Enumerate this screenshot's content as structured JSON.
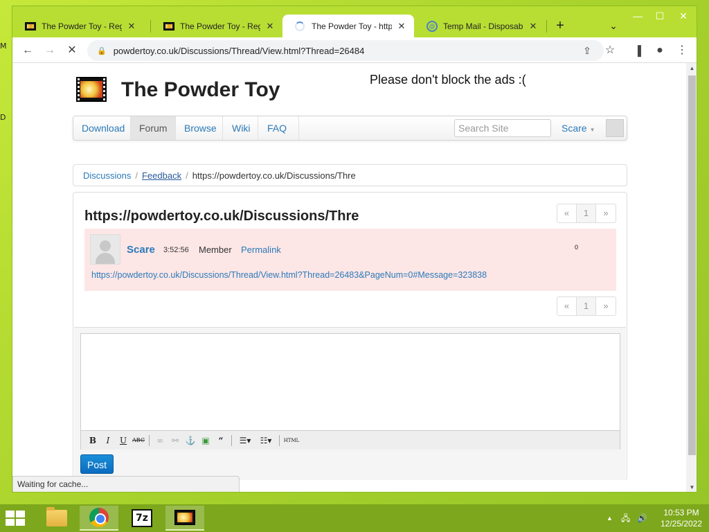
{
  "browser": {
    "tabs": [
      {
        "title": "The Powder Toy - Regis",
        "favicon": "powder-toy-icon",
        "active": false
      },
      {
        "title": "The Powder Toy - Regis",
        "favicon": "powder-toy-icon",
        "active": false
      },
      {
        "title": "The Powder Toy - https",
        "favicon": "loading-spinner-icon",
        "active": true
      },
      {
        "title": "Temp Mail - Disposable",
        "favicon": "temp-mail-icon",
        "active": false
      }
    ],
    "new_tab": "+",
    "tab_search": "⌄",
    "close_glyph": "✕",
    "window_controls": {
      "minimize": "—",
      "maximize": "☐",
      "close": "✕"
    },
    "nav": {
      "back": "←",
      "forward": "→",
      "stop": "✕"
    },
    "url": "powdertoy.co.uk/Discussions/Thread/View.html?Thread=26484",
    "status": "Waiting for cache..."
  },
  "site": {
    "title": "The Powder Toy",
    "ads_message": "Please don't block the ads :(",
    "nav_items": [
      "Download",
      "Forum",
      "Browse",
      "Wiki",
      "FAQ"
    ],
    "active_nav": "Forum",
    "search_placeholder": "Search Site",
    "username": "Scare"
  },
  "breadcrumb": {
    "discussions": "Discussions",
    "feedback": "Feedback",
    "separator": "/",
    "current": "https://powdertoy.co.uk/Discussions/Thre"
  },
  "thread": {
    "title": "https://powdertoy.co.uk/Discussions/Thre",
    "pager": {
      "prev": "«",
      "page": "1",
      "next": "»"
    },
    "post": {
      "author": "Scare",
      "time": "3:52:56",
      "rank": "Member",
      "permalink": "Permalink",
      "score": "0",
      "body": "https://powdertoy.co.uk/Discussions/Thread/View.html?Thread=26483&PageNum=0#Message=323838"
    }
  },
  "editor": {
    "toolbar": {
      "bold": "B",
      "italic": "I",
      "underline": "U",
      "strike": "ABC",
      "html": "HTML"
    },
    "post_button": "Post"
  },
  "taskbar": {
    "time": "10:53 PM",
    "date": "12/25/2022"
  },
  "colors": {
    "desktop": "#a6d12a",
    "tabstrip": "#b8de33",
    "link": "#2a7ab8",
    "post_background": "#fde6e6",
    "post_button": "#0b6cbf",
    "taskbar": "#7da71c"
  }
}
